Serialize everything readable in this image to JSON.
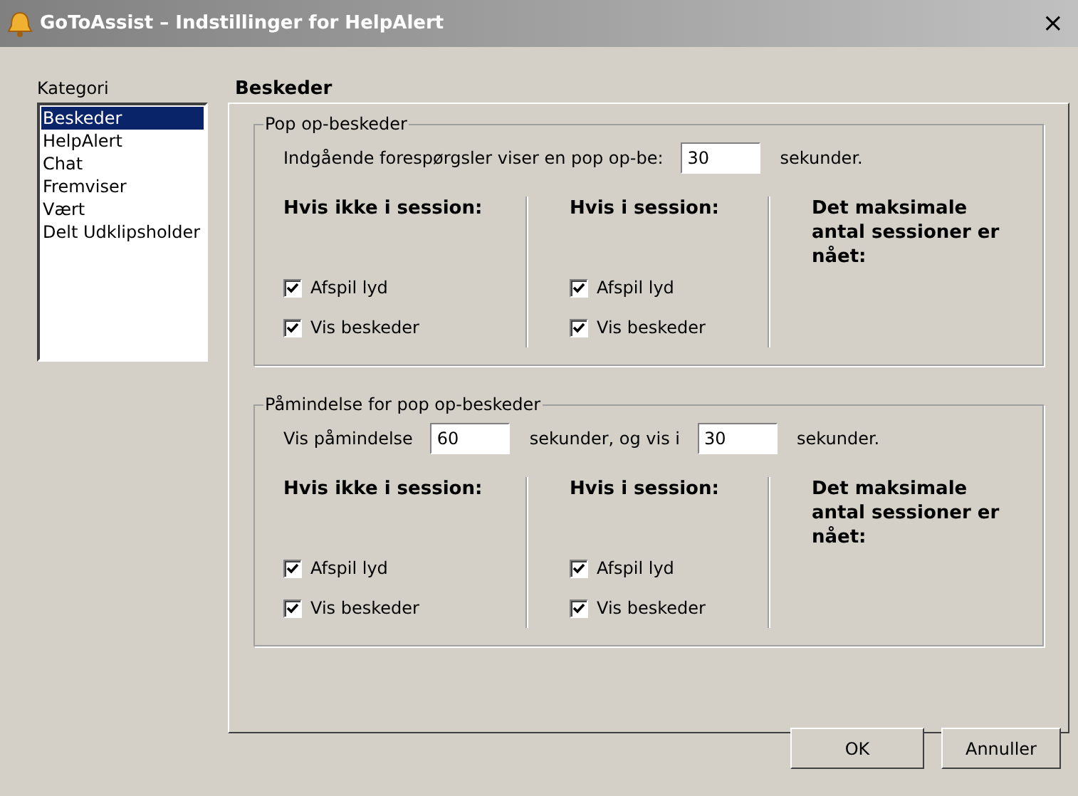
{
  "window": {
    "title": "GoToAssist – Indstillinger for HelpAlert",
    "close": "×"
  },
  "sidebar": {
    "label": "Kategori",
    "items": [
      {
        "label": "Beskeder",
        "selected": true
      },
      {
        "label": "HelpAlert",
        "selected": false
      },
      {
        "label": "Chat",
        "selected": false
      },
      {
        "label": "Fremviser",
        "selected": false
      },
      {
        "label": "Vært",
        "selected": false
      },
      {
        "label": "Delt Udklipsholder",
        "selected": false
      }
    ]
  },
  "panel": {
    "title": "Beskeder",
    "groups": [
      {
        "title": "Pop op-beskeder",
        "row": [
          {
            "kind": "text",
            "text": "Indgående forespørgsler viser en pop op-be:"
          },
          {
            "kind": "field",
            "value": "30"
          },
          {
            "kind": "text",
            "text": "sekunder."
          }
        ],
        "columns": [
          {
            "heading": "Hvis ikke i session:",
            "checkboxes": [
              {
                "label": "Afspil lyd",
                "checked": true
              },
              {
                "label": "Vis beskeder",
                "checked": true
              }
            ]
          },
          {
            "heading": "Hvis i session:",
            "checkboxes": [
              {
                "label": "Afspil lyd",
                "checked": true
              },
              {
                "label": "Vis beskeder",
                "checked": true
              }
            ]
          },
          {
            "heading": "Det maksimale antal sessioner er nået:"
          }
        ]
      },
      {
        "title": "Påmindelse for pop op-beskeder",
        "row": [
          {
            "kind": "text",
            "text": "Vis påmindelse"
          },
          {
            "kind": "field",
            "value": "60"
          },
          {
            "kind": "text",
            "text": "sekunder, og vis i"
          },
          {
            "kind": "field",
            "value": "30"
          },
          {
            "kind": "text",
            "text": "sekunder."
          }
        ],
        "columns": [
          {
            "heading": "Hvis ikke i session:",
            "checkboxes": [
              {
                "label": "Afspil lyd",
                "checked": true
              },
              {
                "label": "Vis beskeder",
                "checked": true
              }
            ]
          },
          {
            "heading": "Hvis i session:",
            "checkboxes": [
              {
                "label": "Afspil lyd",
                "checked": true
              },
              {
                "label": "Vis beskeder",
                "checked": true
              }
            ]
          },
          {
            "heading": "Det maksimale antal sessioner er nået:"
          }
        ]
      }
    ]
  },
  "buttons": [
    "OK",
    "Annuller"
  ]
}
